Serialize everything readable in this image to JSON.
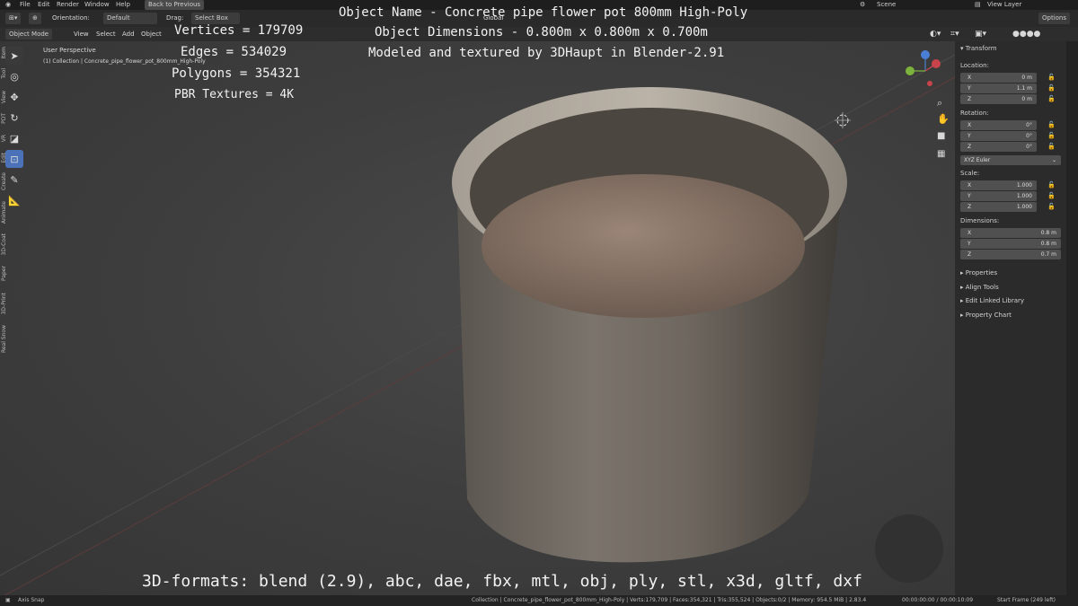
{
  "menu": {
    "file": "File",
    "edit": "Edit",
    "render": "Render",
    "window": "Window",
    "help": "Help",
    "back": "Back to Previous",
    "scene": "Scene",
    "view_layer": "View Layer"
  },
  "toolbar": {
    "orientation_label": "Orientation:",
    "orientation_value": "Default",
    "drag_label": "Drag:",
    "drag_value": "Select Box",
    "global": "Global",
    "options": "Options",
    "mode": "Object Mode",
    "view": "View",
    "select": "Select",
    "add": "Add",
    "object": "Object"
  },
  "viewport": {
    "perspective": "User Perspective",
    "collection": "(1) Collection | Concrete_pipe_flower_pot_800mm_High-Poly"
  },
  "stats": {
    "vertices": "Vertices = 179709",
    "edges": "Edges = 534029",
    "polygons": "Polygons = 354321",
    "pbr": "PBR Textures = 4K"
  },
  "info": {
    "name": "Object Name - Concrete pipe flower pot 800mm High-Poly",
    "dimensions": "Object Dimensions -  0.800m x 0.800m x 0.700m",
    "author": "Modeled and textured by 3DHaupt in Blender-2.91",
    "formats": "3D-formats: blend (2.9), abc, dae, fbx, mtl, obj, ply, stl, x3d, gltf, dxf"
  },
  "transform": {
    "title": "Transform",
    "location_label": "Location:",
    "location": [
      {
        "k": "X",
        "v": "0 m"
      },
      {
        "k": "Y",
        "v": "1.1 m"
      },
      {
        "k": "Z",
        "v": "0 m"
      }
    ],
    "rotation_label": "Rotation:",
    "rotation": [
      {
        "k": "X",
        "v": "0°"
      },
      {
        "k": "Y",
        "v": "0°"
      },
      {
        "k": "Z",
        "v": "0°"
      }
    ],
    "euler": "XYZ Euler",
    "scale_label": "Scale:",
    "scale": [
      {
        "k": "X",
        "v": "1.000"
      },
      {
        "k": "Y",
        "v": "1.000"
      },
      {
        "k": "Z",
        "v": "1.000"
      }
    ],
    "dimensions_label": "Dimensions:",
    "dimensions": [
      {
        "k": "X",
        "v": "0.8 m"
      },
      {
        "k": "Y",
        "v": "0.8 m"
      },
      {
        "k": "Z",
        "v": "0.7 m"
      }
    ]
  },
  "panels": {
    "properties": "Properties",
    "align": "Align Tools",
    "linked": "Edit Linked Library",
    "chart": "Property Chart"
  },
  "tabs": [
    "Item",
    "Tool",
    "View",
    "PDT",
    "VR",
    "Edit",
    "Create",
    "Animate",
    "3D-Coat",
    "Paper",
    "3D-Print",
    "Real Snow"
  ],
  "status": {
    "snap": "Axis Snap",
    "info": "Collection | Concrete_pipe_flower_pot_800mm_High-Poly | Verts:179,709 | Faces:354,321 | Tris:355,524 | Objects:0/2 | Memory: 954.5 MiB | 2.83.4",
    "time": "00:00:00:00 / 00:00:10:09",
    "frame": "Start Frame (249 left)"
  }
}
